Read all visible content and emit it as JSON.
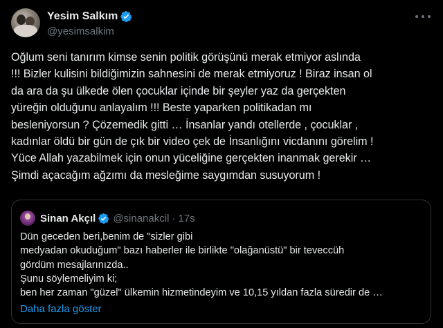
{
  "author": {
    "display_name": "Yesim Salkım",
    "handle": "@yesimsalkim",
    "avatar_icon": "profile-photo",
    "verified_icon": "verified-badge-icon"
  },
  "menu_icon": "more-horizontal-icon",
  "tweet_text": "Oğlum seni tanırım kimse senin politik görüşünü merak etmiyor aslında\n!!! Bizler kulisini bildiğimizin sahnesini de merak etmiyoruz ! Biraz insan ol\nda ara da şu ülkede ölen çocuklar içinde bir şeyler yaz da gerçekten\nyüreğin olduğunu anlayalım !!! Beste yaparken politikadan mı\nbesleniyorsun ? Çözemedik gitti … İnsanlar yandı otellerde , çocuklar ,\nkadınlar öldü bir gün de çık bir video çek de İnsanlığını vicdanını görelim !\nYüce Allah yazabilmek için onun yüceliğine gerçekten inanmak gerekir …\nŞimdi açacağım ağzımı da mesleğime saygımdan susuyorum !",
  "quoted_tweet": {
    "display_name": "Sinan Akçıl",
    "handle": "@sinanakcil",
    "separator": "·",
    "time": "17s",
    "text": "Dün geceden beri,benim de \"sizler gibi\nmedyadan okuduğum\" bazı haberler ile birlikte \"olağanüstü\" bir teveccüh\ngördüm mesajlarınızda..\nŞunu söylemeliyim ki;\nben her zaman \"güzel\" ülkemin hizmetindeyim ve 10,15 yıldan fazla süredir de …",
    "show_more_label": "Daha fazla göster"
  },
  "colors": {
    "background": "#000000",
    "text": "#e7e9ea",
    "secondary_text": "#71767b",
    "link": "#1d9bf0",
    "verified": "#1d9bf0",
    "border": "#2f3336"
  }
}
